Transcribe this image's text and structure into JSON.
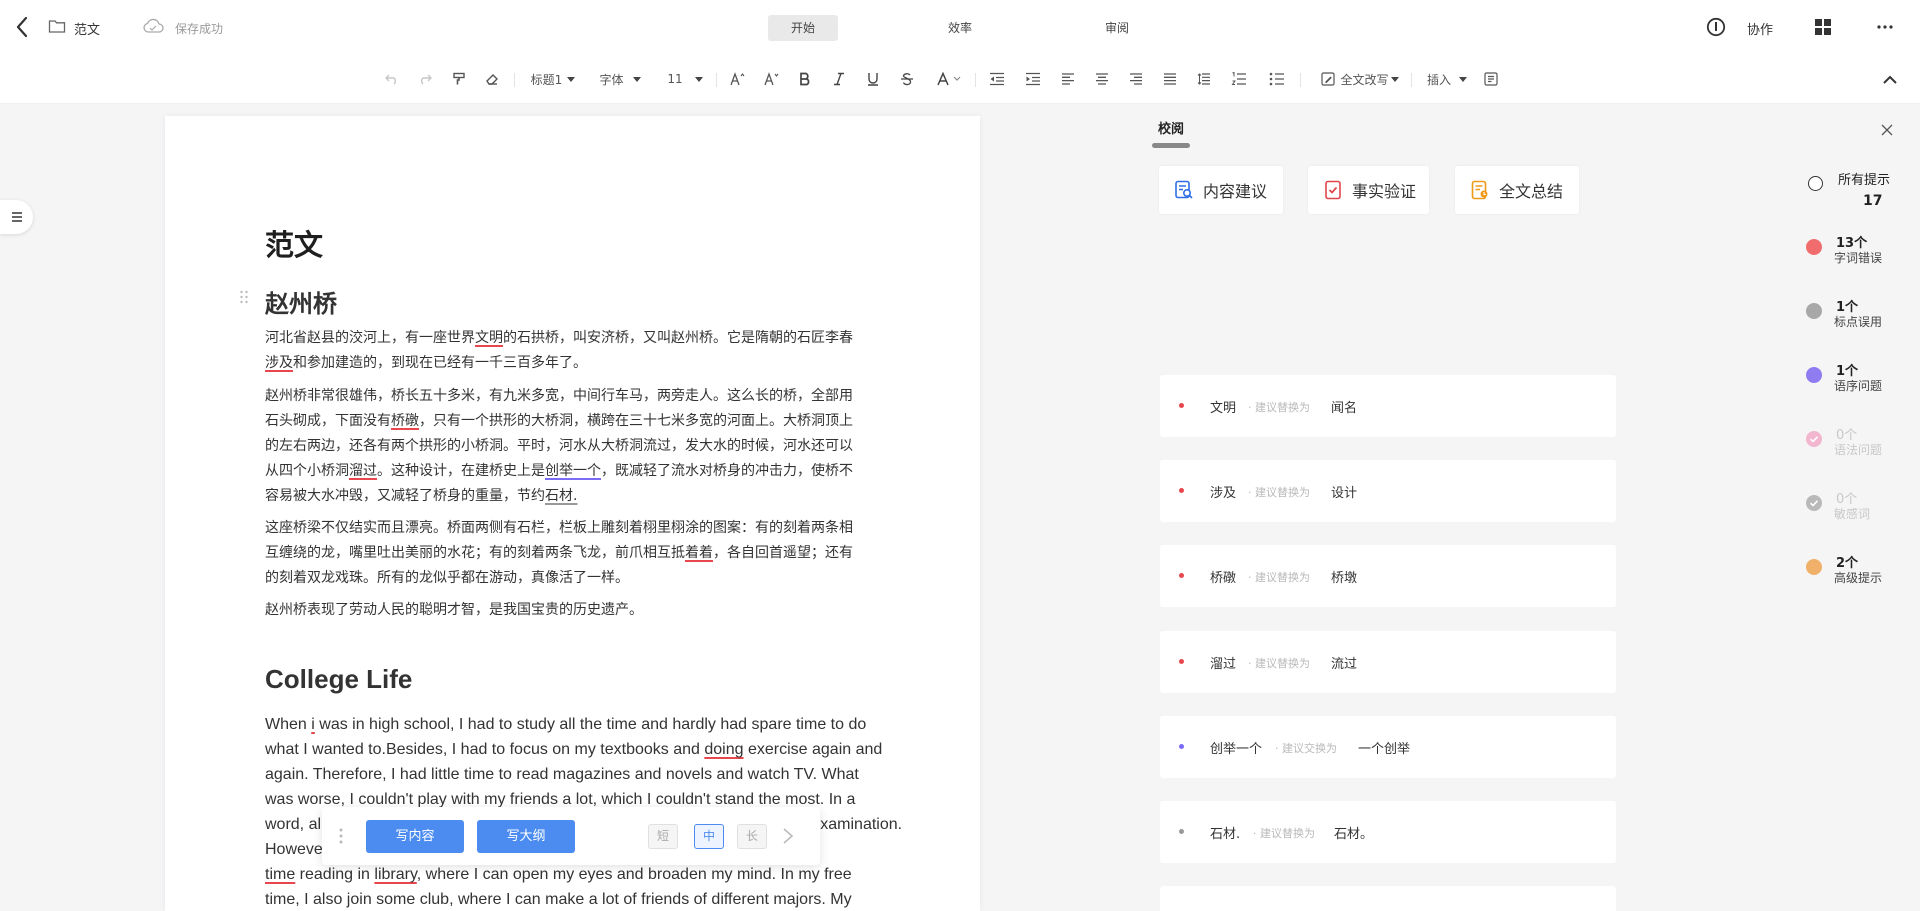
{
  "header": {
    "doc_name": "范文",
    "save_status": "保存成功",
    "tabs": [
      {
        "label": "开始",
        "active": true
      },
      {
        "label": "效率",
        "active": false
      },
      {
        "label": "审阅",
        "active": false
      }
    ],
    "collab_label": "协作",
    "icons": [
      "back-icon",
      "folder-icon",
      "cloud-icon",
      "info-icon",
      "grid-icon",
      "more-icon"
    ]
  },
  "toolbar": {
    "heading_style": "标题1",
    "font": "字体",
    "font_size": "11",
    "rewrite": "全文改写",
    "insert": "插入"
  },
  "document": {
    "title": "范文",
    "section1_heading": "赵州桥",
    "section2_heading": "College Life"
  },
  "ai_bar": {
    "write_content": "写内容",
    "write_outline": "写大纲",
    "lengths": [
      {
        "label": "短",
        "active": false
      },
      {
        "label": "中",
        "active": true
      },
      {
        "label": "长",
        "active": false
      }
    ]
  },
  "review_panel": {
    "tab": "校阅",
    "features": [
      {
        "label": "内容建议",
        "icon": "content-suggest-icon"
      },
      {
        "label": "事实验证",
        "icon": "fact-check-icon"
      },
      {
        "label": "全文总结",
        "icon": "summary-icon"
      }
    ],
    "suggestions": [
      {
        "original": "文明",
        "hint": "· 建议替换为",
        "replacement": "闻名",
        "color": "#e8474d"
      },
      {
        "original": "涉及",
        "hint": "· 建议替换为",
        "replacement": "设计",
        "color": "#e8474d"
      },
      {
        "original": "桥礅",
        "hint": "· 建议替换为",
        "replacement": "桥墩",
        "color": "#e8474d"
      },
      {
        "original": "溜过",
        "hint": "· 建议替换为",
        "replacement": "流过",
        "color": "#e8474d"
      },
      {
        "original": "创举一个",
        "hint": "· 建议交换为",
        "replacement": "一个创举",
        "color": "#7b6cf6"
      },
      {
        "original": "石材.",
        "hint": "· 建议替换为",
        "replacement": "石材。",
        "color": "#999999"
      }
    ],
    "categories": [
      {
        "count": "所有提示",
        "label": "17",
        "color": "none"
      },
      {
        "count": "13个",
        "label": "字词错误",
        "color": "#f16d6d"
      },
      {
        "count": "1个",
        "label": "标点误用",
        "color": "#a8a8a8"
      },
      {
        "count": "1个",
        "label": "语序问题",
        "color": "#8e7cf0"
      },
      {
        "count": "0个",
        "label": "语法问题",
        "color": "#f3b6cf"
      },
      {
        "count": "0个",
        "label": "敏感词",
        "color": "#c9c9c9"
      },
      {
        "count": "2个",
        "label": "高级提示",
        "color": "#f0b06a"
      }
    ]
  }
}
